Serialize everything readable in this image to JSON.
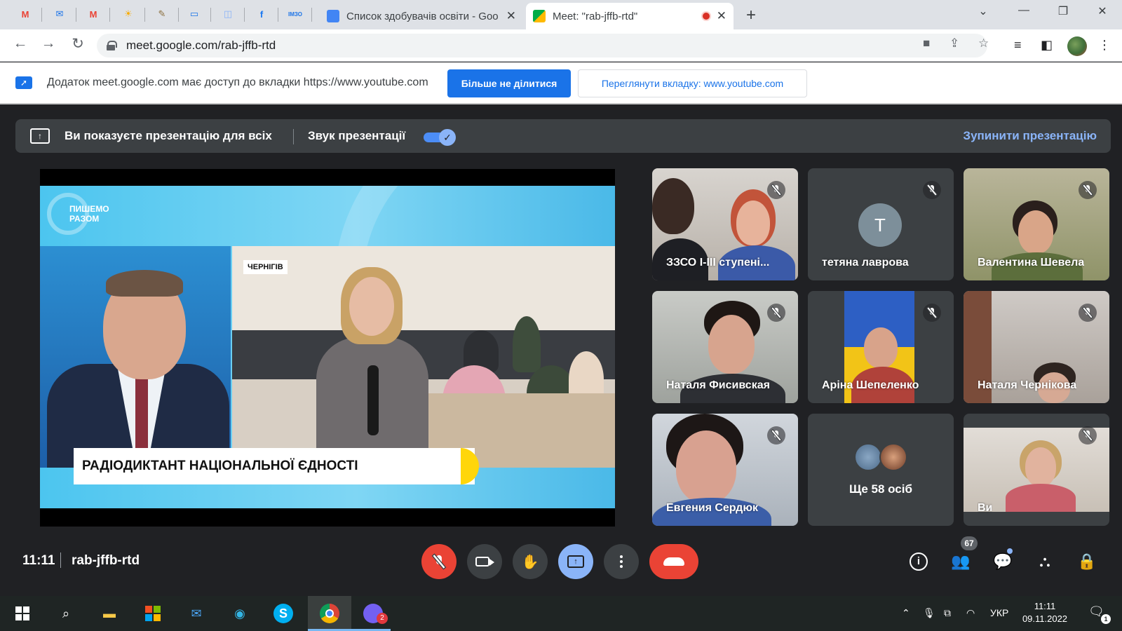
{
  "browser": {
    "pinned_tabs": [
      {
        "icon": "gmail-icon",
        "glyph": "M",
        "color": "#ea4335"
      },
      {
        "icon": "messenger-icon",
        "glyph": "✉",
        "color": "#1a73e8"
      },
      {
        "icon": "gmail-icon",
        "glyph": "M",
        "color": "#ea4335"
      },
      {
        "icon": "sun-icon",
        "glyph": "☀",
        "color": "#f9ab00"
      },
      {
        "icon": "pen-icon",
        "glyph": "✎",
        "color": "#8a6d3b"
      },
      {
        "icon": "slides-icon",
        "glyph": "▭",
        "color": "#1a73e8"
      },
      {
        "icon": "map-icon",
        "glyph": "◫",
        "color": "#8ab4f8"
      },
      {
        "icon": "facebook-icon",
        "glyph": "f",
        "color": "#1877f2"
      },
      {
        "icon": "imzo-icon",
        "glyph": "ІМЗО",
        "color": "#1a73e8"
      }
    ],
    "tabs": [
      {
        "title": "Список здобувачів освіти - Goo",
        "icon": "docs-icon",
        "active": false
      },
      {
        "title": "Meet: \"rab-jffb-rtd\"",
        "icon": "meet-icon",
        "active": true
      }
    ],
    "url": "meet.google.com/rab-jffb-rtd"
  },
  "infobar": {
    "message": "Додаток meet.google.com має доступ до вкладки https://www.youtube.com",
    "stop_button": "Більше не ділитися",
    "view_button": "Переглянути вкладку: www.youtube.com"
  },
  "presentation_bar": {
    "status": "Ви показуєте презентацію для всіх",
    "sound_label": "Звук презентації",
    "sound_on": true,
    "stop_label": "Зупинити презентацію"
  },
  "video": {
    "logo_line1": "ПИШЕМО",
    "logo_line2": "РАЗОМ",
    "city_tag": "ЧЕРНІГІВ",
    "headline": "РАДІОДИКТАНТ НАЦІОНАЛЬНОЇ ЄДНОСТІ"
  },
  "participants": [
    {
      "name": "ЗЗСО І-ІІІ ступені..."
    },
    {
      "name": "тетяна лаврова",
      "initial": "Т"
    },
    {
      "name": "Валентина Шевела"
    },
    {
      "name": "Наталя Фисивская"
    },
    {
      "name": "Аріна Шепеленко"
    },
    {
      "name": "Наталя Чернікова"
    },
    {
      "name": "Евгения Сердюк"
    },
    {
      "name": "Ще 58 осіб"
    },
    {
      "name": "Ви"
    }
  ],
  "bottom": {
    "time": "11:11",
    "meeting_code": "rab-jffb-rtd",
    "people_count": "67"
  },
  "taskbar": {
    "language": "УКР",
    "time": "11:11",
    "date": "09.11.2022",
    "viber_badge": "2",
    "notification_count": "1"
  }
}
